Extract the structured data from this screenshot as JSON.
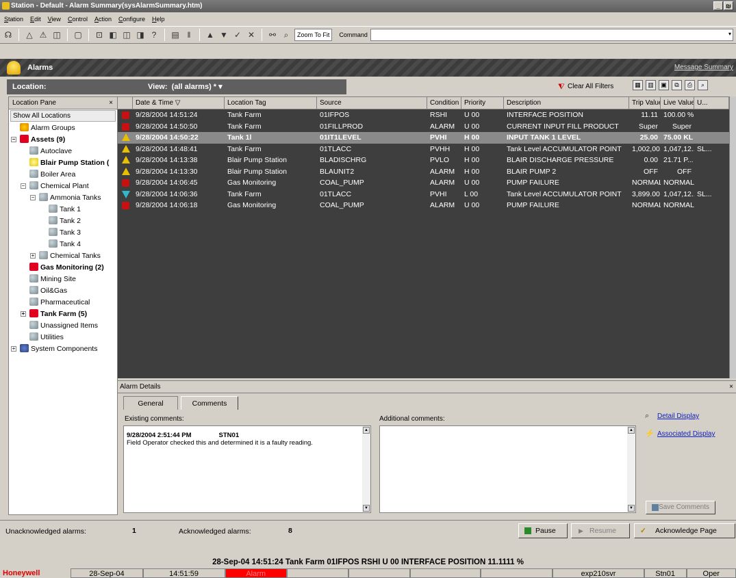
{
  "window": {
    "title": "Station - Default - Alarm Summary(sysAlarmSummary.htm)",
    "buttons": [
      "_",
      "₪"
    ]
  },
  "menu": [
    "Station",
    "Edit",
    "View",
    "Control",
    "Action",
    "Configure",
    "Help"
  ],
  "toolbar": {
    "zoom": "Zoom To Fit",
    "command_label": "Command",
    "command_value": ""
  },
  "header": {
    "title": "Alarms",
    "message_summary": "Message Summary"
  },
  "locbar": {
    "location_label": "Location:",
    "view_label": "View:",
    "view_value": "(all alarms) * ▾"
  },
  "clear_filters": "Clear All Filters",
  "location_pane": {
    "title": "Location Pane",
    "close": "×",
    "show_all": "Show All Locations",
    "nodes": [
      {
        "label": "Alarm Groups",
        "indent": 0,
        "icon": "star",
        "bold": false,
        "pm": ""
      },
      {
        "label": "Assets (9)",
        "indent": 0,
        "icon": "red",
        "bold": true,
        "pm": "−"
      },
      {
        "label": "Autoclave",
        "indent": 1,
        "icon": "grp",
        "bold": false,
        "pm": ""
      },
      {
        "label": "Blair Pump Station (",
        "indent": 1,
        "icon": "bell",
        "bold": true,
        "pm": ""
      },
      {
        "label": "Boiler Area",
        "indent": 1,
        "icon": "grp",
        "bold": false,
        "pm": ""
      },
      {
        "label": "Chemical Plant",
        "indent": 1,
        "icon": "grp",
        "bold": false,
        "pm": "−"
      },
      {
        "label": "Ammonia Tanks",
        "indent": 2,
        "icon": "grp",
        "bold": false,
        "pm": "−"
      },
      {
        "label": "Tank 1",
        "indent": 3,
        "icon": "grp",
        "bold": false,
        "pm": ""
      },
      {
        "label": "Tank 2",
        "indent": 3,
        "icon": "grp",
        "bold": false,
        "pm": ""
      },
      {
        "label": "Tank 3",
        "indent": 3,
        "icon": "grp",
        "bold": false,
        "pm": ""
      },
      {
        "label": "Tank 4",
        "indent": 3,
        "icon": "grp",
        "bold": false,
        "pm": ""
      },
      {
        "label": "Chemical Tanks",
        "indent": 2,
        "icon": "grp",
        "bold": false,
        "pm": "+"
      },
      {
        "label": "Gas Monitoring (2)",
        "indent": 1,
        "icon": "red",
        "bold": true,
        "pm": ""
      },
      {
        "label": "Mining Site",
        "indent": 1,
        "icon": "grp",
        "bold": false,
        "pm": ""
      },
      {
        "label": "Oil&Gas",
        "indent": 1,
        "icon": "grp",
        "bold": false,
        "pm": ""
      },
      {
        "label": "Pharmaceutical",
        "indent": 1,
        "icon": "grp",
        "bold": false,
        "pm": ""
      },
      {
        "label": "Tank Farm (5)",
        "indent": 1,
        "icon": "red",
        "bold": true,
        "pm": "+"
      },
      {
        "label": "Unassigned Items",
        "indent": 1,
        "icon": "grp",
        "bold": false,
        "pm": ""
      },
      {
        "label": "Utilities",
        "indent": 1,
        "icon": "grp",
        "bold": false,
        "pm": ""
      },
      {
        "label": "System Components",
        "indent": 0,
        "icon": "sys",
        "bold": false,
        "pm": "+"
      }
    ]
  },
  "grid": {
    "columns": [
      "",
      "Date & Time ▽",
      "Location Tag",
      "Source",
      "Condition",
      "Priority",
      "Description",
      "Trip Value",
      "Live Value",
      "U..."
    ],
    "rows": [
      {
        "sev": "red",
        "cells": [
          "9/28/2004 14:51:24",
          "Tank Farm",
          "01IFPOS",
          "RSHI",
          "U 00",
          "INTERFACE POSITION",
          "11.11",
          "100.00 %",
          ""
        ]
      },
      {
        "sev": "red",
        "cells": [
          "9/28/2004 14:50:50",
          "Tank Farm",
          "01FILLPROD",
          "ALARM",
          "U 00",
          "CURRENT INPUT FILL PRODUCT",
          "Super",
          "Super",
          ""
        ]
      },
      {
        "sev": "yel",
        "sel": true,
        "cells": [
          "9/28/2004 14:50:22",
          "Tank 1l",
          "01IT1LEVEL",
          "PVHI",
          "H 00",
          "INPUT TANK 1 LEVEL",
          "25.00",
          "75.00 KL",
          ""
        ]
      },
      {
        "sev": "yel",
        "cells": [
          "9/28/2004 14:48:41",
          "Tank Farm",
          "01TLACC",
          "PVHH",
          "H 00",
          "Tank Level ACCUMULATOR POINT",
          "1,002,00...",
          "1,047,12...",
          "SL..."
        ]
      },
      {
        "sev": "yel",
        "cells": [
          "9/28/2004 14:13:38",
          "Blair Pump Station",
          "BLADISCHRG",
          "PVLO",
          "H 00",
          "BLAIR DISCHARGE PRESSURE",
          "0.00",
          "21.71 P...",
          ""
        ]
      },
      {
        "sev": "yel",
        "cells": [
          "9/28/2004 14:13:30",
          "Blair Pump Station",
          "BLAUNIT2",
          "ALARM",
          "H 00",
          "BLAIR PUMP 2",
          "OFF",
          "OFF",
          ""
        ]
      },
      {
        "sev": "red",
        "cells": [
          "9/28/2004 14:06:45",
          "Gas Monitoring",
          "COAL_PUMP",
          "ALARM",
          "U 00",
          "PUMP FAILURE",
          "NORMAL",
          "NORMAL",
          ""
        ]
      },
      {
        "sev": "cyan",
        "cells": [
          "9/28/2004 14:06:36",
          "Tank Farm",
          "01TLACC",
          "PVHI",
          "L 00",
          "Tank Level ACCUMULATOR POINT",
          "3,899.00",
          "1,047,12...",
          "SL..."
        ]
      },
      {
        "sev": "red",
        "cells": [
          "9/28/2004 14:06:18",
          "Gas Monitoring",
          "COAL_PUMP",
          "ALARM",
          "U 00",
          "PUMP FAILURE",
          "NORMAL",
          "NORMAL",
          ""
        ]
      }
    ]
  },
  "details": {
    "title": "Alarm Details",
    "close": "×",
    "tabs": [
      "General",
      "Comments"
    ],
    "existing_label": "Existing comments:",
    "additional_label": "Additional comments:",
    "comment_time": "9/28/2004 2:51:44 PM",
    "comment_user": "STN01",
    "comment_text": "Field Operator checked this and determined it is a faulty reading.",
    "detail_display": "Detail Display",
    "associated_display": "Associated Display",
    "save_comments": "Save Comments"
  },
  "counts": {
    "unack_label": "Unacknowledged alarms:",
    "unack_value": "1",
    "ack_label": "Acknowledged alarms:",
    "ack_value": "8",
    "pause": "Pause",
    "resume": "Resume",
    "ack_page": "Acknowledge Page"
  },
  "message_line": "28-Sep-04  14:51:24  Tank Farm  01IFPOS   RSHI   U 00 INTERFACE POSITION   11.1111  %",
  "statusbar": {
    "brand": "Honeywell",
    "date": "28-Sep-04",
    "time": "14:51:59",
    "alarm": "Alarm",
    "server": "exp210svr",
    "station": "Stn01",
    "mode": "Oper"
  },
  "colors": {
    "alarm_red": "#ff0000",
    "urgent": "#c81010",
    "high": "#e8c000",
    "low": "#30b8c8"
  }
}
